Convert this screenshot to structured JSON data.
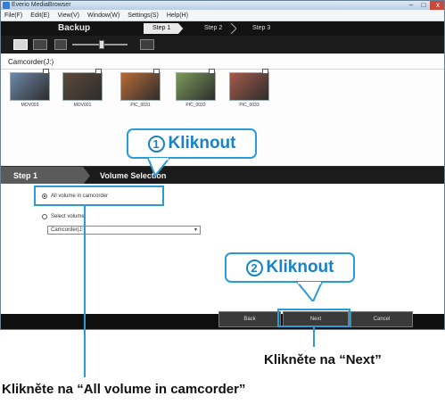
{
  "window": {
    "title": "Everio MediaBrowser",
    "buttons": [
      "–",
      "□",
      "x"
    ]
  },
  "menu": [
    "File(F)",
    "Edit(E)",
    "View(V)",
    "Window(W)",
    "Settings(S)",
    "Help(H)"
  ],
  "wizard": {
    "title": "Backup",
    "steps": [
      "Step 1",
      "Step 2",
      "Step 3"
    ]
  },
  "toolbar": {
    "icons": [
      "thumbnail-view-icon",
      "list-view-icon",
      "timeline-view-icon",
      "zoom-slider",
      "full-view-icon",
      "voice-icon"
    ]
  },
  "source": {
    "label": "Camcorder(J:)",
    "thumbnails": [
      {
        "caption": "MOV003",
        "color": "#6d87a8"
      },
      {
        "caption": "MOV001",
        "color": "#5c4a3a"
      },
      {
        "caption": "PIC_0031",
        "color": "#b86a37"
      },
      {
        "caption": "PIC_0032",
        "color": "#7b9a5a"
      },
      {
        "caption": "PIC_0033",
        "color": "#a45a4a"
      }
    ]
  },
  "volume": {
    "step_label": "Step 1",
    "title": "Volume Selection",
    "option_all": "All volume in camcorder",
    "option_select": "Select volume",
    "select_value": "Camcorder(J:)",
    "buttons": {
      "back": "Back",
      "next": "Next",
      "cancel": "Cancel"
    }
  },
  "annotations": {
    "callout1_num": "1",
    "callout1_text": "Kliknout",
    "callout2_num": "2",
    "callout2_text": "Kliknout",
    "caption_next": "Klikněte na “Next”",
    "caption_all": "Klikněte na “All volume in camcorder”"
  },
  "colors": {
    "accent": "#2a9bd6",
    "dark": "#111111"
  }
}
